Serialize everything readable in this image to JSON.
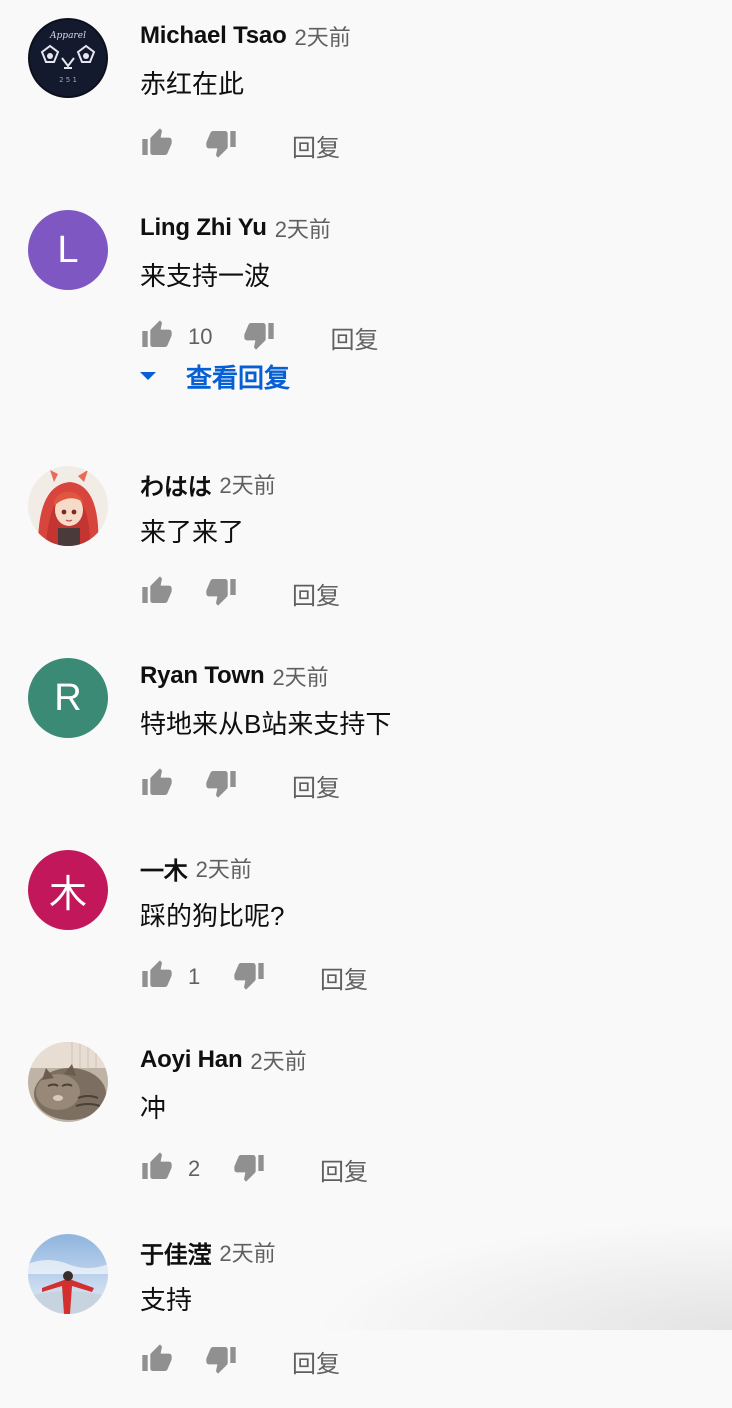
{
  "comments": [
    {
      "author": "Michael Tsao",
      "time": "2天前",
      "text": "赤红在此",
      "likes": "",
      "reply_label": "回复",
      "avatar": {
        "type": "image",
        "icon": "dark-emblem-avatar"
      }
    },
    {
      "author": "Ling Zhi Yu",
      "time": "2天前",
      "text": "来支持一波",
      "likes": "10",
      "reply_label": "回复",
      "avatar": {
        "type": "letter",
        "letter": "L",
        "color": "#7e57c2"
      },
      "view_replies": "查看回复"
    },
    {
      "author": "わはは",
      "time": "2天前",
      "text": "来了来了",
      "likes": "",
      "reply_label": "回复",
      "avatar": {
        "type": "image",
        "icon": "anime-character-avatar"
      }
    },
    {
      "author": "Ryan Town",
      "time": "2天前",
      "text": "特地来从B站来支持下",
      "likes": "",
      "reply_label": "回复",
      "avatar": {
        "type": "letter",
        "letter": "R",
        "color": "#3a8a75"
      }
    },
    {
      "author": "一木",
      "time": "2天前",
      "text": "踩的狗比呢?",
      "likes": "1",
      "reply_label": "回复",
      "avatar": {
        "type": "letter",
        "letter": "木",
        "color": "#c2185b"
      }
    },
    {
      "author": "Aoyi Han",
      "time": "2天前",
      "text": "冲",
      "likes": "2",
      "reply_label": "回复",
      "avatar": {
        "type": "image",
        "icon": "cat-photo-avatar"
      }
    },
    {
      "author": "于佳滢",
      "time": "2天前",
      "text": "支持",
      "likes": "",
      "reply_label": "回复",
      "avatar": {
        "type": "image",
        "icon": "sky-person-avatar"
      }
    }
  ],
  "colors": {
    "background": "#f9f9f9",
    "link": "#065fd4",
    "secondary_text": "#606060",
    "icon": "#909090"
  }
}
